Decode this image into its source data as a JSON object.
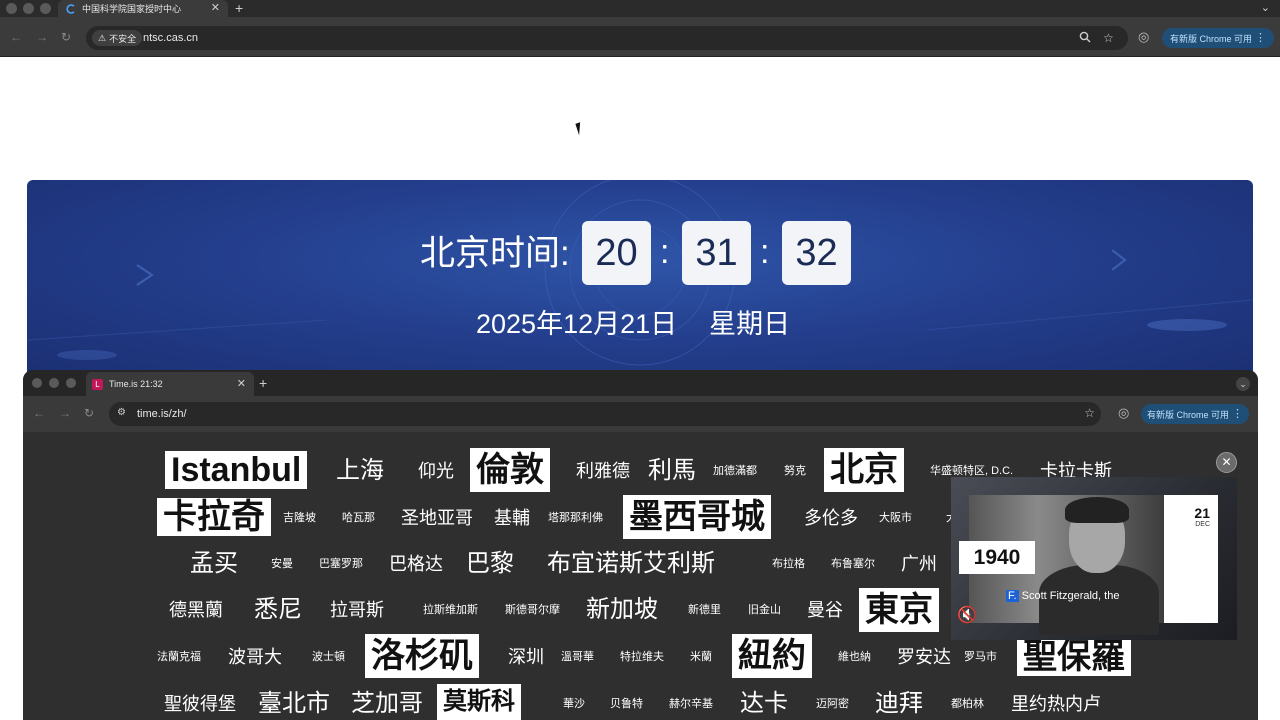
{
  "browser_top": {
    "tab_title": "中国科学院国家授时中心",
    "security_label": "不安全",
    "url": "ntsc.cas.cn",
    "update_label": "有新版 Chrome 可用"
  },
  "ntsc": {
    "time_label": "北京时间:",
    "hours": "20",
    "minutes": "31",
    "seconds": "32",
    "separator": ":",
    "date": "2025年12月21日",
    "weekday": "星期日"
  },
  "browser_second": {
    "tab_title": "Time.is 21:32",
    "url": "time.is/zh/",
    "update_label": "有新版 Chrome 可用"
  },
  "cities": {
    "r1": [
      "Istanbul",
      "上海",
      "仰光",
      "倫敦",
      "利雅德",
      "利馬",
      "加德滿都",
      "努克",
      "北京",
      "华盛顿特区, D.C.",
      "卡拉卡斯"
    ],
    "r2": [
      "卡拉奇",
      "吉隆坡",
      "哈瓦那",
      "圣地亚哥",
      "基輔",
      "塔那那利佛",
      "墨西哥城",
      "多伦多",
      "大阪市",
      "大"
    ],
    "r3": [
      "孟买",
      "安曼",
      "巴塞罗那",
      "巴格达",
      "巴黎",
      "布宜诺斯艾利斯",
      "布拉格",
      "布鲁塞尔",
      "广州"
    ],
    "r4": [
      "德黑蘭",
      "悉尼",
      "拉哥斯",
      "拉斯维加斯",
      "斯德哥尔摩",
      "新加坡",
      "新德里",
      "旧金山",
      "曼谷",
      "東京"
    ],
    "r5": [
      "法蘭克福",
      "波哥大",
      "波士頓",
      "洛杉矶",
      "深圳",
      "溫哥華",
      "特拉维夫",
      "米蘭",
      "紐約",
      "維也納",
      "罗安达",
      "罗马市",
      "聖保羅"
    ],
    "r6": [
      "聖彼得堡",
      "臺北市",
      "芝加哥",
      "莫斯科",
      "華沙",
      "贝鲁特",
      "赫尔辛基",
      "达卡",
      "迈阿密",
      "迪拜",
      "都柏林",
      "里约热内卢"
    ]
  },
  "pip_video": {
    "calendar_day": "21",
    "calendar_month": "DEC",
    "year": "1940",
    "caption_cc": "F.",
    "caption_text": " Scott Fitzgerald, the"
  },
  "colors": {
    "banner": "#243f8e",
    "chrome_dark": "#3b3b3b",
    "update_pill": "#1f4f76",
    "time_box": "#f2f4f8"
  }
}
